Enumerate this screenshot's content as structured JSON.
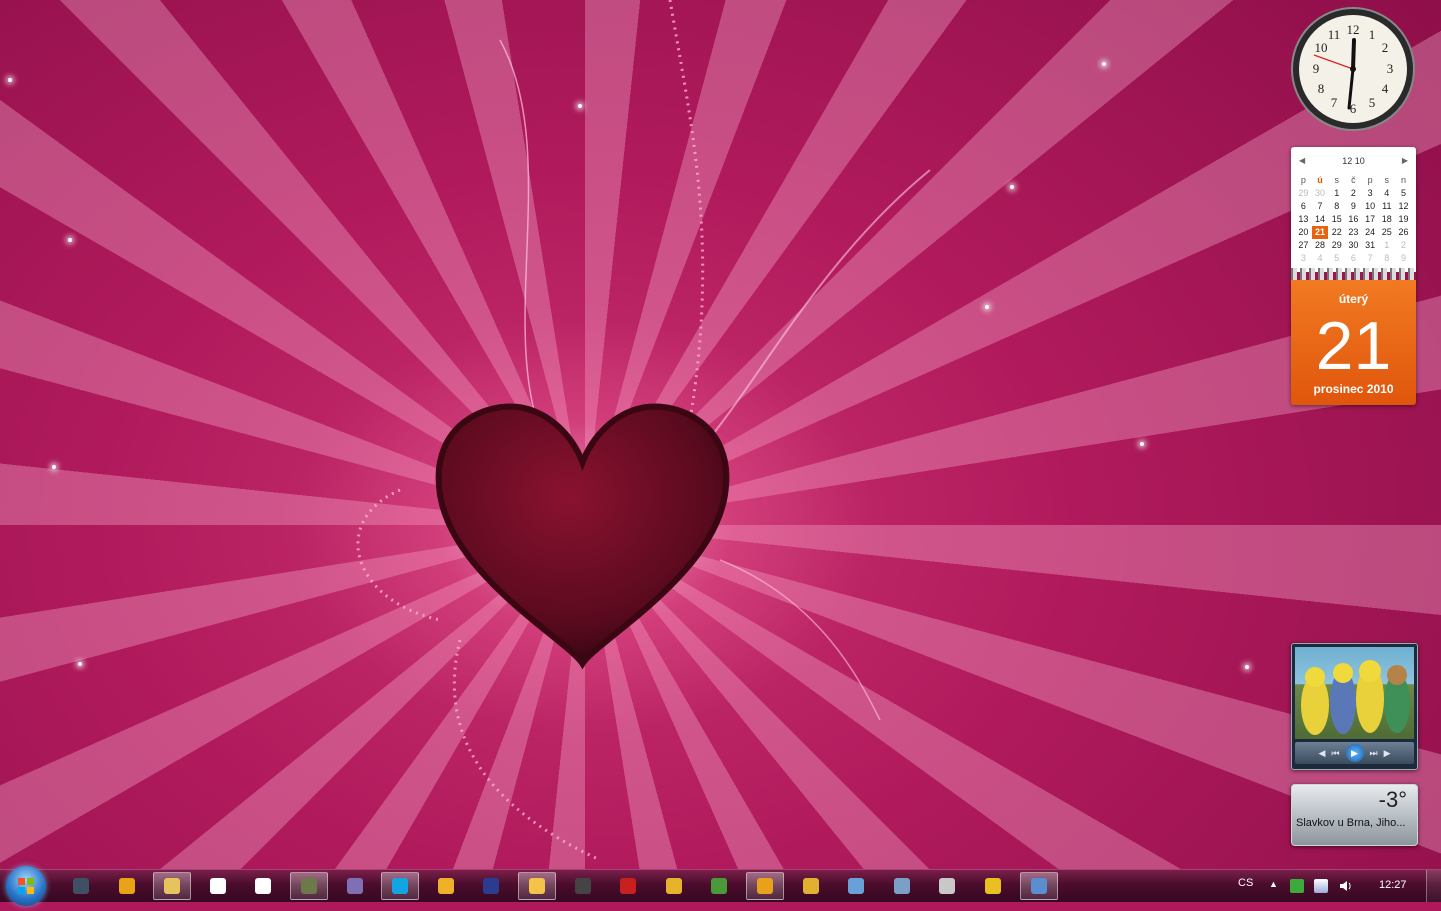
{
  "clock": {
    "hour_numbers": [
      "12",
      "1",
      "2",
      "3",
      "4",
      "5",
      "6",
      "7",
      "8",
      "9",
      "10",
      "11"
    ],
    "time": "12:27"
  },
  "calendar": {
    "header": "12 10",
    "weekdays": [
      "p",
      "ú",
      "s",
      "č",
      "p",
      "s",
      "n"
    ],
    "weeks": [
      [
        "29",
        "30",
        "1",
        "2",
        "3",
        "4",
        "5"
      ],
      [
        "6",
        "7",
        "8",
        "9",
        "10",
        "11",
        "12"
      ],
      [
        "13",
        "14",
        "15",
        "16",
        "17",
        "18",
        "19"
      ],
      [
        "20",
        "21",
        "22",
        "23",
        "24",
        "25",
        "26"
      ],
      [
        "27",
        "28",
        "29",
        "30",
        "31",
        "1",
        "2"
      ],
      [
        "3",
        "4",
        "5",
        "6",
        "7",
        "8",
        "9"
      ]
    ],
    "weekday_name": "úterý",
    "day": "21",
    "month_year": "prosinec 2010"
  },
  "weather": {
    "temperature": "-3°",
    "location": "Slavkov u Brna, Jiho..."
  },
  "taskbar": {
    "apps": [
      {
        "name": "remote-desktop",
        "color": "#3f4f66",
        "active": false
      },
      {
        "name": "avast",
        "color": "#e8a317",
        "active": false
      },
      {
        "name": "explorer",
        "color": "#e6c35c",
        "active": true
      },
      {
        "name": "chat-bubble-1",
        "color": "#ffffff",
        "active": false
      },
      {
        "name": "chat-bubble-2",
        "color": "#ffffff",
        "active": false
      },
      {
        "name": "winamp",
        "color": "#6c7a4a",
        "active": true
      },
      {
        "name": "pidgin",
        "color": "#7f6fb5",
        "active": false
      },
      {
        "name": "skype",
        "color": "#12a5e3",
        "active": true
      },
      {
        "name": "lightning-app",
        "color": "#f0b12a",
        "active": false
      },
      {
        "name": "app-h",
        "color": "#2b3b8f",
        "active": false
      },
      {
        "name": "disc-app",
        "color": "#f4c44a",
        "active": true
      },
      {
        "name": "film-app",
        "color": "#444444",
        "active": false
      },
      {
        "name": "filezilla",
        "color": "#c8201e",
        "active": false
      },
      {
        "name": "archive-app",
        "color": "#e6b42c",
        "active": false
      },
      {
        "name": "network-app",
        "color": "#4b9a3a",
        "active": false
      },
      {
        "name": "chrome",
        "color": "#e8a11a",
        "active": true
      },
      {
        "name": "tools-app",
        "color": "#e0b030",
        "active": false
      },
      {
        "name": "display-app",
        "color": "#6aa0d8",
        "active": false
      },
      {
        "name": "windows-app",
        "color": "#7aa0c8",
        "active": false
      },
      {
        "name": "media-app",
        "color": "#c8c8c8",
        "active": false
      },
      {
        "name": "ie-app",
        "color": "#e8c020",
        "active": false
      },
      {
        "name": "screen-app",
        "color": "#5a8ed0",
        "active": true
      }
    ],
    "tray_language": "CS",
    "tray_arrow": "▲",
    "clock": "12:27"
  }
}
